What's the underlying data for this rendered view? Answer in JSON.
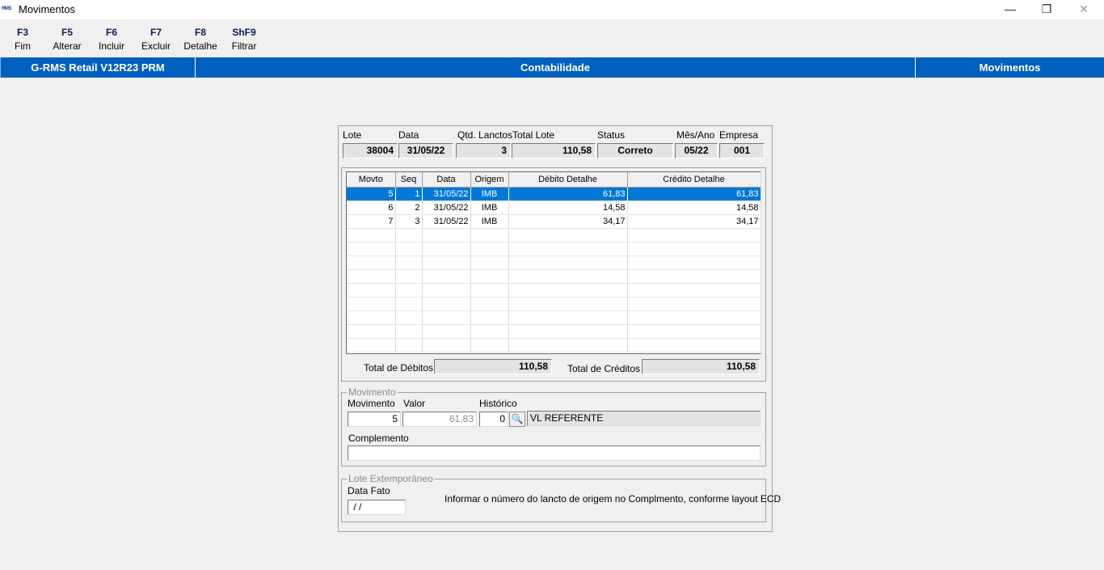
{
  "window": {
    "logo_text": "RMS",
    "title": "Movimentos",
    "minimize_glyph": "—",
    "maximize_glyph": "❐",
    "close_glyph": "✕"
  },
  "toolbar": {
    "buttons": [
      {
        "key": "F3",
        "label": "Fim"
      },
      {
        "key": "F5",
        "label": "Alterar"
      },
      {
        "key": "F6",
        "label": "Incluir"
      },
      {
        "key": "F7",
        "label": "Excluir"
      },
      {
        "key": "F8",
        "label": "Detalhe"
      },
      {
        "key": "ShF9",
        "label": "Filtrar"
      }
    ]
  },
  "header": {
    "system": "G-RMS Retail V12R23 PRM",
    "module": "Contabilidade",
    "screen": "Movimentos"
  },
  "lote": {
    "labels": {
      "lote": "Lote",
      "data": "Data",
      "qtd": "Qtd. Lanctos",
      "total": "Total Lote",
      "status": "Status",
      "mes_ano": "Mês/Ano",
      "empresa": "Empresa"
    },
    "values": {
      "lote": "38004",
      "data": "31/05/22",
      "qtd": "3",
      "total": "110,58",
      "status": "Correto",
      "mes_ano": "05/22",
      "empresa": "001"
    }
  },
  "grid": {
    "columns": [
      "Movto",
      "Seq",
      "Data",
      "Origem",
      "Débito Detalhe",
      "Crédito Detalhe"
    ],
    "rows": [
      [
        "5",
        "1",
        "31/05/22",
        "IMB",
        "61,83",
        "61,83"
      ],
      [
        "6",
        "2",
        "31/05/22",
        "IMB",
        "14,58",
        "14,58"
      ],
      [
        "7",
        "3",
        "31/05/22",
        "IMB",
        "34,17",
        "34,17"
      ]
    ],
    "selected_row": 0
  },
  "totals": {
    "debitos_label": "Total de Débitos :",
    "debitos_value": "110,58",
    "creditos_label": "Total de Créditos :",
    "creditos_value": "110,58"
  },
  "movimento": {
    "group_title": "Movimento",
    "movimento_label": "Movimento",
    "movimento_value": "5",
    "valor_label": "Valor",
    "valor_value": "61,83",
    "historico_label": "Histórico",
    "historico_code": "0",
    "historico_text": "VL REFERENTE",
    "search_icon_glyph": "🔍",
    "complemento_label": "Complemento",
    "complemento_value": ""
  },
  "extemporaneo": {
    "group_title": "Lote Extemporâneo",
    "data_fato_label": "Data Fato",
    "data_fato_value": " / /",
    "info_text": "Informar o número do lancto de origem no Complmento, conforme layout ECD"
  }
}
